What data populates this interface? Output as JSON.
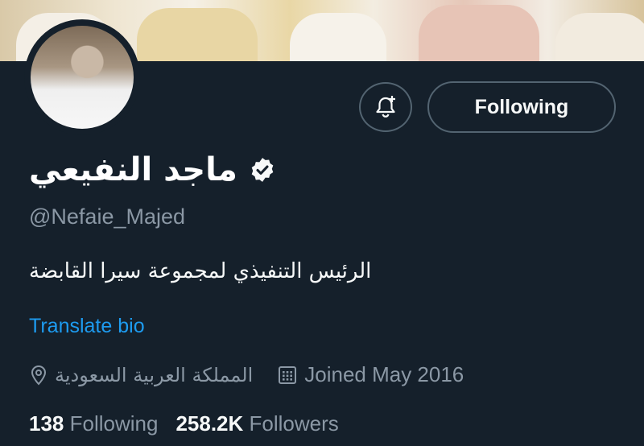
{
  "profile": {
    "name": "ماجد النفيعي",
    "handle": "@Nefaie_Majed",
    "bio": "الرئيس التنفيذي لمجموعة سيرا القابضة",
    "translate_label": "Translate bio",
    "location": "المملكة العربية السعودية",
    "joined": "Joined May 2016",
    "verified_icon": "verified-badge-icon"
  },
  "actions": {
    "notify_icon": "bell-plus-icon",
    "following_label": "Following"
  },
  "stats": {
    "following_count": "138",
    "following_label": "Following",
    "followers_count": "258.2K",
    "followers_label": "Followers"
  },
  "colors": {
    "background": "#15202b",
    "accent": "#1d9bf0",
    "secondary_text": "#8b98a5",
    "border": "#536471"
  }
}
